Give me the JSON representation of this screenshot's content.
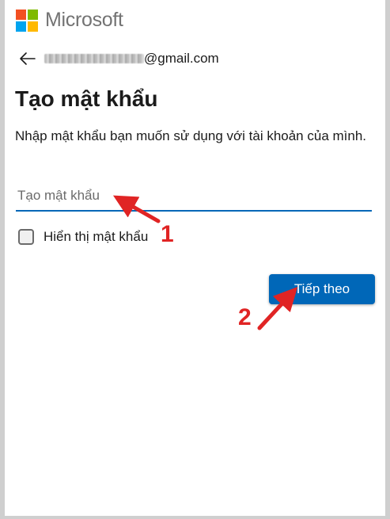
{
  "brand": {
    "name": "Microsoft",
    "colors": [
      "#f25022",
      "#7fba00",
      "#00a4ef",
      "#ffb900"
    ]
  },
  "identity": {
    "back_icon": "arrow-left-icon",
    "email_visible": "@gmail.com"
  },
  "page": {
    "title": "Tạo mật khẩu",
    "description": "Nhập mật khẩu bạn muốn sử dụng với tài khoản của mình."
  },
  "password_field": {
    "placeholder": "Tạo mật khẩu",
    "value": ""
  },
  "show_password": {
    "label": "Hiển thị mật khẩu",
    "checked": false
  },
  "next_button": {
    "label": "Tiếp theo",
    "color": "#0067b8"
  },
  "annotations": {
    "step1": "1",
    "step2": "2",
    "color": "#e02424"
  }
}
